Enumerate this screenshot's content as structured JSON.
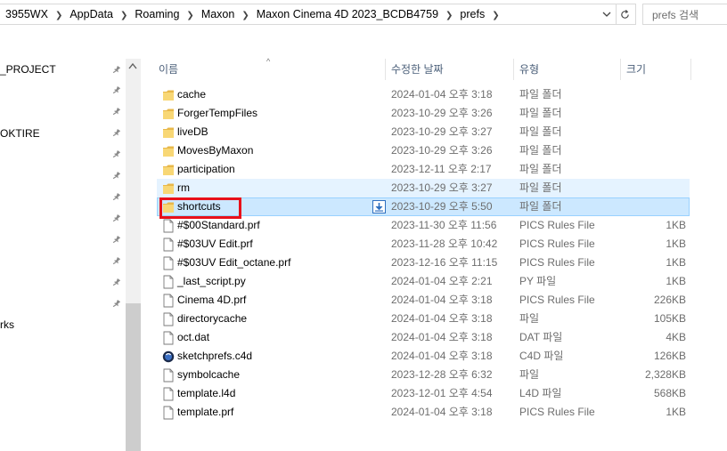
{
  "address": {
    "breadcrumbs": [
      "3955WX",
      "AppData",
      "Roaming",
      "Maxon",
      "Maxon Cinema 4D 2023_BCDB4759",
      "prefs"
    ]
  },
  "search": {
    "placeholder": "prefs 검색"
  },
  "nav": {
    "items": [
      "_PROJECT",
      "OKTIRE",
      "rks"
    ]
  },
  "columns": {
    "name": "이름",
    "date": "수정한 날짜",
    "type": "유형",
    "size": "크기"
  },
  "files": [
    {
      "name": "cache",
      "date": "2024-01-04 오후 3:18",
      "type": "파일 폴더",
      "size": "",
      "icon": "folder-icon"
    },
    {
      "name": "ForgerTempFiles",
      "date": "2023-10-29 오후 3:26",
      "type": "파일 폴더",
      "size": "",
      "icon": "folder-icon"
    },
    {
      "name": "liveDB",
      "date": "2023-10-29 오후 3:27",
      "type": "파일 폴더",
      "size": "",
      "icon": "folder-icon"
    },
    {
      "name": "MovesByMaxon",
      "date": "2023-10-29 오후 3:26",
      "type": "파일 폴더",
      "size": "",
      "icon": "folder-icon"
    },
    {
      "name": "participation",
      "date": "2023-12-11 오후 2:17",
      "type": "파일 폴더",
      "size": "",
      "icon": "folder-icon"
    },
    {
      "name": "rm",
      "date": "2023-10-29 오후 3:27",
      "type": "파일 폴더",
      "size": "",
      "icon": "folder-icon",
      "state": "hover"
    },
    {
      "name": "shortcuts",
      "date": "2023-10-29 오후 5:50",
      "type": "파일 폴더",
      "size": "",
      "icon": "folder-icon",
      "state": "selected"
    },
    {
      "name": "#$00Standard.prf",
      "date": "2023-11-30 오후 11:56",
      "type": "PICS Rules File",
      "size": "1KB",
      "icon": "file-icon"
    },
    {
      "name": "#$03UV Edit.prf",
      "date": "2023-11-28 오후 10:42",
      "type": "PICS Rules File",
      "size": "1KB",
      "icon": "file-icon"
    },
    {
      "name": "#$03UV Edit_octane.prf",
      "date": "2023-12-16 오후 11:15",
      "type": "PICS Rules File",
      "size": "1KB",
      "icon": "file-icon"
    },
    {
      "name": "_last_script.py",
      "date": "2024-01-04 오후 2:21",
      "type": "PY 파일",
      "size": "1KB",
      "icon": "file-icon"
    },
    {
      "name": "Cinema 4D.prf",
      "date": "2024-01-04 오후 3:18",
      "type": "PICS Rules File",
      "size": "226KB",
      "icon": "file-icon"
    },
    {
      "name": "directorycache",
      "date": "2024-01-04 오후 3:18",
      "type": "파일",
      "size": "105KB",
      "icon": "file-icon"
    },
    {
      "name": "oct.dat",
      "date": "2024-01-04 오후 3:18",
      "type": "DAT 파일",
      "size": "4KB",
      "icon": "file-icon"
    },
    {
      "name": "sketchprefs.c4d",
      "date": "2024-01-04 오후 3:18",
      "type": "C4D 파일",
      "size": "126KB",
      "icon": "c4d-icon"
    },
    {
      "name": "symbolcache",
      "date": "2023-12-28 오후 6:32",
      "type": "파일",
      "size": "2,328KB",
      "icon": "file-icon"
    },
    {
      "name": "template.l4d",
      "date": "2023-12-01 오후 4:54",
      "type": "L4D 파일",
      "size": "568KB",
      "icon": "file-icon"
    },
    {
      "name": "template.prf",
      "date": "2024-01-04 오후 3:18",
      "type": "PICS Rules File",
      "size": "1KB",
      "icon": "file-icon"
    }
  ],
  "colors": {
    "folder": "#f8d775",
    "selected_bg": "#cce8ff",
    "hover_bg": "#e5f3ff",
    "highlight": "#e8101a",
    "header_text": "#4c607a"
  }
}
